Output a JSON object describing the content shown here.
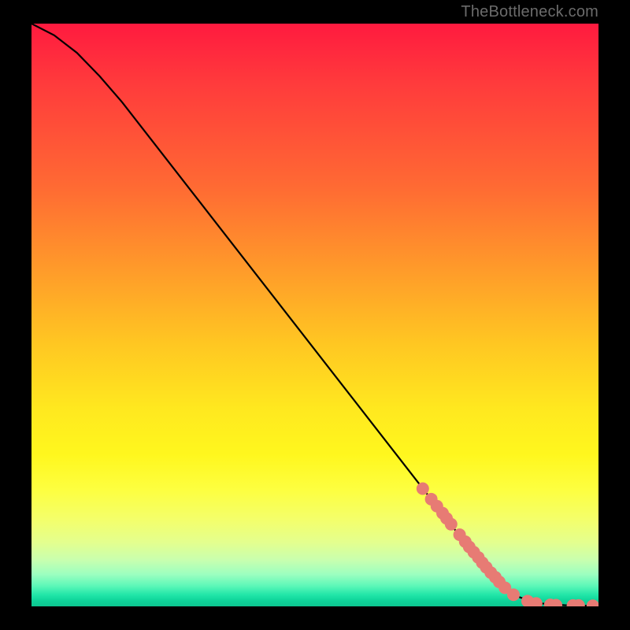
{
  "watermark": "TheBottleneck.com",
  "colors": {
    "dot": "#e77b74",
    "curve": "#000000",
    "frame": "#000000"
  },
  "chart_data": {
    "type": "line",
    "title": "",
    "xlabel": "",
    "ylabel": "",
    "xlim": [
      0,
      100
    ],
    "ylim": [
      0,
      100
    ],
    "grid": false,
    "series": [
      {
        "name": "bottleneck-curve",
        "x": [
          0,
          4,
          8,
          12,
          16,
          20,
          24,
          28,
          32,
          36,
          40,
          44,
          48,
          52,
          56,
          60,
          64,
          68,
          72,
          76,
          80,
          82,
          84,
          86,
          88,
          90,
          92,
          94,
          96,
          98,
          100
        ],
        "y": [
          100,
          98,
          95,
          91,
          86.5,
          81.5,
          76.5,
          71.5,
          66.5,
          61.5,
          56.5,
          51.5,
          46.5,
          41.5,
          36.5,
          31.5,
          26.5,
          21.5,
          16.5,
          11.5,
          6.5,
          4.5,
          2.8,
          1.6,
          0.9,
          0.5,
          0.3,
          0.2,
          0.15,
          0.1,
          0.1
        ]
      }
    ],
    "points": {
      "name": "highlighted-dots",
      "x": [
        69,
        70.5,
        71.5,
        72.5,
        73.2,
        74,
        75.5,
        76.5,
        77.2,
        78,
        78.8,
        79.5,
        80.2,
        81,
        81.8,
        82.5,
        83.5,
        85,
        87.5,
        89,
        91.5,
        92.5,
        95.5,
        96.5,
        99
      ],
      "y": [
        20.2,
        18.4,
        17.2,
        16,
        15.1,
        14.1,
        12.3,
        11.1,
        10.2,
        9.3,
        8.4,
        7.5,
        6.7,
        5.8,
        5,
        4.2,
        3.2,
        2,
        0.9,
        0.5,
        0.25,
        0.2,
        0.15,
        0.15,
        0.1
      ]
    }
  }
}
